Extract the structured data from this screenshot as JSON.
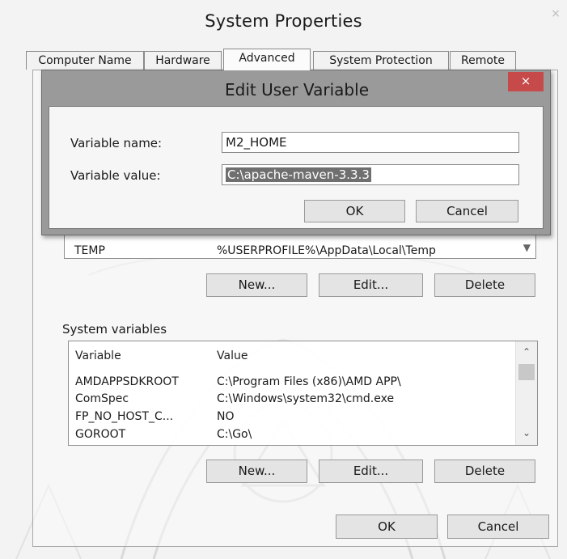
{
  "window": {
    "title": "System Properties",
    "close_glyph": "×"
  },
  "tabs": [
    {
      "label": "Computer Name"
    },
    {
      "label": "Hardware"
    },
    {
      "label": "Advanced"
    },
    {
      "label": "System Protection"
    },
    {
      "label": "Remote"
    }
  ],
  "user_variables": {
    "rows": [
      {
        "variable": "TEMP",
        "value": "%USERPROFILE%\\AppData\\Local\\Temp"
      }
    ],
    "buttons": {
      "new": "New...",
      "edit": "Edit...",
      "delete": "Delete"
    }
  },
  "system_variables": {
    "label": "System variables",
    "headers": {
      "variable": "Variable",
      "value": "Value"
    },
    "rows": [
      {
        "variable": "AMDAPPSDKROOT",
        "value": "C:\\Program Files (x86)\\AMD APP\\"
      },
      {
        "variable": "ComSpec",
        "value": "C:\\Windows\\system32\\cmd.exe"
      },
      {
        "variable": "FP_NO_HOST_C...",
        "value": "NO"
      },
      {
        "variable": "GOROOT",
        "value": "C:\\Go\\"
      }
    ],
    "buttons": {
      "new": "New...",
      "edit": "Edit...",
      "delete": "Delete"
    }
  },
  "footer_buttons": {
    "ok": "OK",
    "cancel": "Cancel"
  },
  "dialog": {
    "title": "Edit User Variable",
    "close_glyph": "×",
    "name_label": "Variable name:",
    "name_value": "M2_HOME",
    "value_label": "Variable value:",
    "value_value": "C:\\apache-maven-3.3.3",
    "ok": "OK",
    "cancel": "Cancel"
  },
  "icons": {
    "scroll_up": "up-chevron-icon",
    "scroll_down": "down-chevron-icon"
  },
  "colors": {
    "dialog_close_bg": "#c74a4a",
    "selection_bg": "#6f6f6f"
  }
}
